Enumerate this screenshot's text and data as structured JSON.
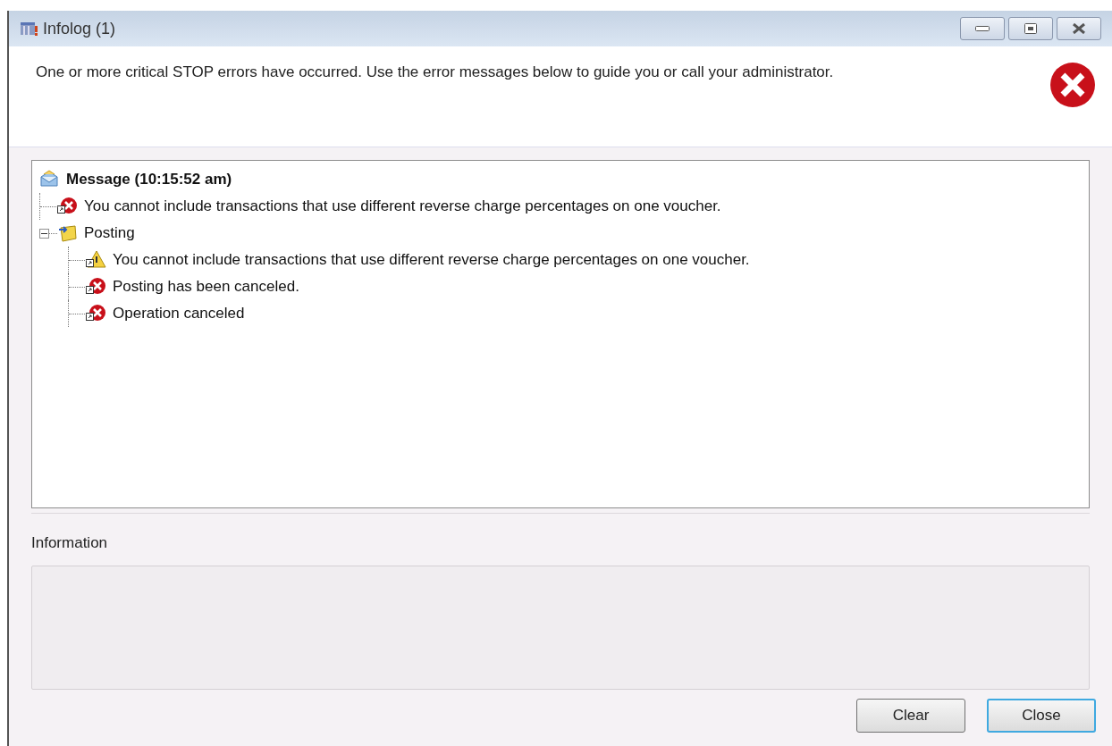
{
  "window": {
    "title": "Infolog (1)"
  },
  "header": {
    "message": "One or more critical STOP errors have occurred. Use the error messages below to guide you or call your administrator."
  },
  "tree": [
    {
      "kind": "message",
      "label": "Message (10:15:52 am)",
      "children": [
        {
          "kind": "error",
          "label": "You cannot include transactions that use different reverse charge percentages on one voucher."
        },
        {
          "kind": "group",
          "label": "Posting",
          "expanded": true,
          "children": [
            {
              "kind": "warning",
              "label": "You cannot include transactions that use different reverse charge percentages on one voucher."
            },
            {
              "kind": "error",
              "label": "Posting has been canceled."
            },
            {
              "kind": "error",
              "label": "Operation canceled"
            }
          ]
        }
      ]
    }
  ],
  "information": {
    "label": "Information"
  },
  "buttons": [
    {
      "label": "Clear",
      "focused": false
    },
    {
      "label": "Close",
      "focused": true
    }
  ]
}
